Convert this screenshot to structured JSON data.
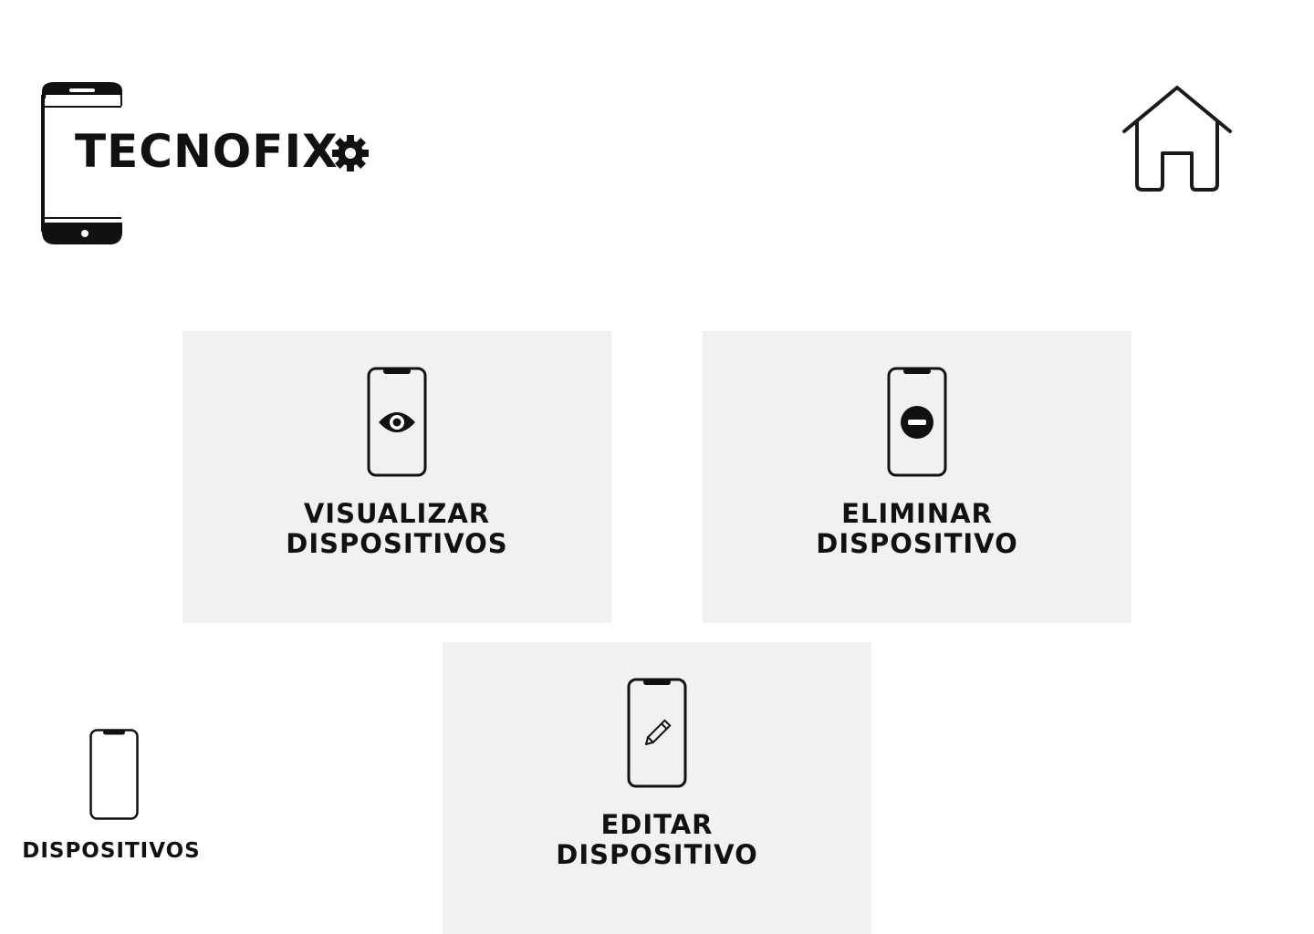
{
  "brand": {
    "name": "TECNOFIX",
    "logo_icon": "phone-icon",
    "gear_icon": "gear-icon"
  },
  "header": {
    "home_icon": "home-icon"
  },
  "cards": {
    "view": {
      "line1": "VISUALIZAR",
      "line2": "DISPOSITIVOS",
      "icon": "phone-eye-icon"
    },
    "delete": {
      "line1": "ELIMINAR",
      "line2": "DISPOSITIVO",
      "icon": "phone-minus-icon"
    },
    "edit": {
      "line1": "EDITAR",
      "line2": "DISPOSITIVO",
      "icon": "phone-pencil-icon"
    }
  },
  "sidebar": {
    "devices_label": "DISPOSITIVOS",
    "devices_icon": "phone-icon"
  },
  "colors": {
    "background": "#ffffff",
    "card_background": "#f1f1f1",
    "foreground": "#111111"
  }
}
